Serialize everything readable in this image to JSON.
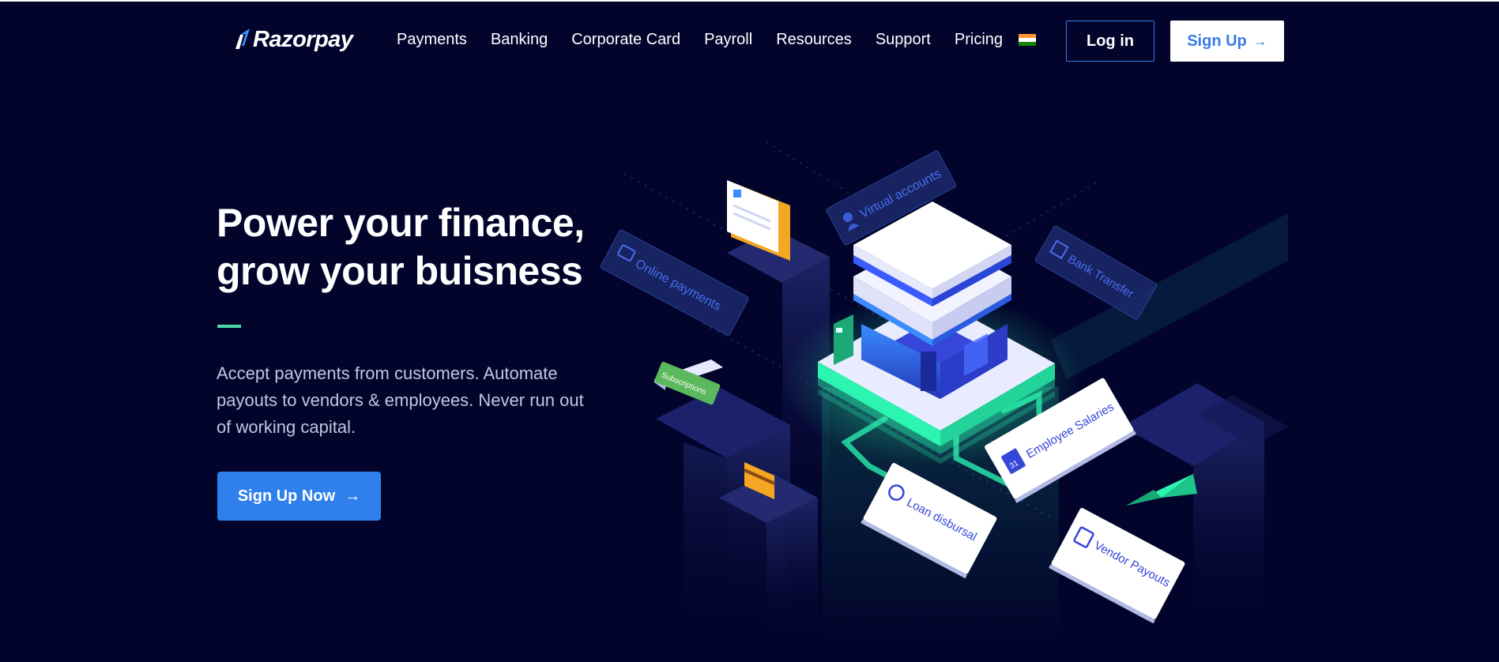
{
  "brand": {
    "name": "Razorpay",
    "logo_icon": "razorpay-logo-icon"
  },
  "nav": {
    "items": [
      {
        "label": "Payments"
      },
      {
        "label": "Banking"
      },
      {
        "label": "Corporate Card"
      },
      {
        "label": "Payroll"
      },
      {
        "label": "Resources"
      },
      {
        "label": "Support"
      },
      {
        "label": "Pricing"
      }
    ],
    "flag_icon": "india-flag-icon",
    "login_label": "Log in",
    "signup_label": "Sign Up",
    "signup_arrow": "→"
  },
  "hero": {
    "title_line1": "Power your finance,",
    "title_line2": "grow your buisness",
    "desc_line1": "Accept payments from customers. Automate",
    "desc_line2": "payouts to vendors & employees. Never run out",
    "desc_line3": "of working capital.",
    "cta_label": "Sign Up Now",
    "cta_arrow": "→"
  },
  "illustration": {
    "cards": {
      "virtual_accounts": "Virtual accounts",
      "online_payments": "Online payments",
      "bank_transfer": "Bank Transfer",
      "subscriptions": "Subscriptions",
      "employee_salaries": "Employee Salaries",
      "calendar_day": "31",
      "loan_disbursal": "Loan disbursal",
      "vendor_payouts": "Vendor Payouts"
    }
  },
  "colors": {
    "background": "#02042b",
    "accent_blue": "#2f80ed",
    "accent_green": "#4cd9a8",
    "card_blue": "#1b2a6b",
    "glow": "#2bf5b1"
  }
}
